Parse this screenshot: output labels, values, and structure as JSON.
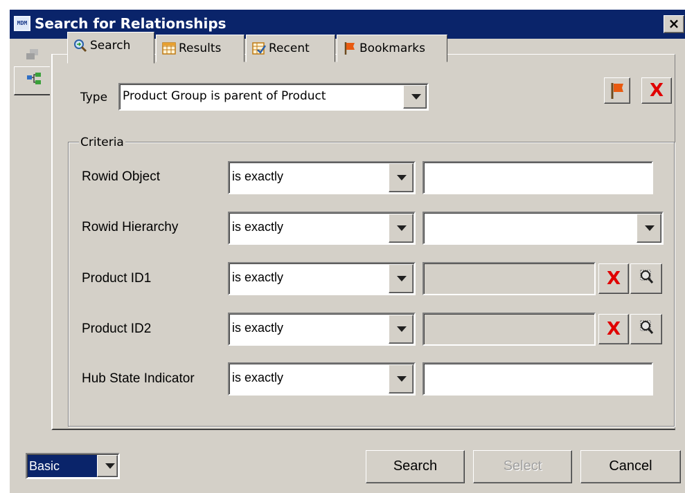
{
  "window": {
    "title": "Search for Relationships",
    "icon_text": "MDM",
    "close_glyph": "×"
  },
  "tabs": [
    {
      "label": "Search",
      "icon": "search-magnifier-icon",
      "selected": true
    },
    {
      "label": "Results",
      "icon": "grid-icon",
      "selected": false
    },
    {
      "label": "Recent",
      "icon": "recent-check-icon",
      "selected": false
    },
    {
      "label": "Bookmarks",
      "icon": "flag-icon",
      "selected": false
    }
  ],
  "type_field": {
    "label": "Type",
    "value": "Product Group is parent of Product"
  },
  "criteria": {
    "title": "Criteria",
    "rows": [
      {
        "label": "Rowid Object",
        "operator": "is exactly",
        "value": ""
      },
      {
        "label": "Rowid Hierarchy",
        "operator": "is exactly",
        "value": ""
      },
      {
        "label": "Product ID1",
        "operator": "is exactly",
        "value": ""
      },
      {
        "label": "Product ID2",
        "operator": "is exactly",
        "value": ""
      },
      {
        "label": "Hub State Indicator",
        "operator": "is exactly",
        "value": ""
      }
    ]
  },
  "footer": {
    "mode": "Basic",
    "search_label": "Search",
    "select_label": "Select",
    "cancel_label": "Cancel"
  },
  "colors": {
    "titlebar": "#0a246a",
    "dialog_bg": "#d4d0c8",
    "clear_x": "#e00000",
    "selection": "#0a246a"
  }
}
